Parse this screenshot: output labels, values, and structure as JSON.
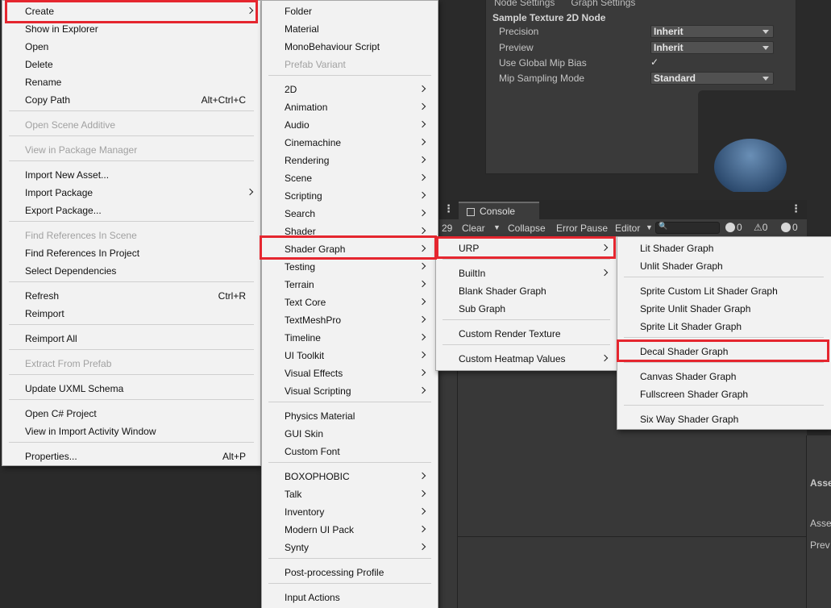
{
  "inspector": {
    "tabs": [
      "Node Settings",
      "Graph Settings"
    ],
    "title": "Sample Texture 2D Node",
    "rows": [
      {
        "label": "Precision",
        "value": "Inherit"
      },
      {
        "label": "Preview",
        "value": "Inherit"
      },
      {
        "label": "Use Global Mip Bias",
        "value": "✓"
      },
      {
        "label": "Mip Sampling Mode",
        "value": "Standard"
      }
    ]
  },
  "console": {
    "tab_label": "Console",
    "count_left": "29",
    "clear": "Clear",
    "collapse": "Collapse",
    "error_pause": "Error Pause",
    "editor": "Editor",
    "log_count": "0",
    "warn_count": "0",
    "error_count": "0"
  },
  "right_strip": {
    "label1": "Asse",
    "label2": "Asse",
    "label3": "Prev"
  },
  "menu1": {
    "items": [
      {
        "label": "Create",
        "submenu": true
      },
      {
        "label": "Show in Explorer"
      },
      {
        "label": "Open"
      },
      {
        "label": "Delete"
      },
      {
        "label": "Rename"
      },
      {
        "label": "Copy Path",
        "shortcut": "Alt+Ctrl+C"
      },
      {
        "label": "Open Scene Additive",
        "disabled": true
      },
      {
        "label": "View in Package Manager",
        "disabled": true
      },
      {
        "label": "Import New Asset..."
      },
      {
        "label": "Import Package",
        "submenu": true
      },
      {
        "label": "Export Package..."
      },
      {
        "label": "Find References In Scene",
        "disabled": true
      },
      {
        "label": "Find References In Project"
      },
      {
        "label": "Select Dependencies"
      },
      {
        "label": "Refresh",
        "shortcut": "Ctrl+R"
      },
      {
        "label": "Reimport"
      },
      {
        "label": "Reimport All"
      },
      {
        "label": "Extract From Prefab",
        "disabled": true
      },
      {
        "label": "Update UXML Schema"
      },
      {
        "label": "Open C# Project"
      },
      {
        "label": "View in Import Activity Window"
      },
      {
        "label": "Properties...",
        "shortcut": "Alt+P"
      }
    ]
  },
  "menu2": {
    "items": [
      {
        "label": "Folder"
      },
      {
        "label": "Material"
      },
      {
        "label": "MonoBehaviour Script"
      },
      {
        "label": "Prefab Variant",
        "disabled": true
      },
      {
        "label": "2D",
        "submenu": true
      },
      {
        "label": "Animation",
        "submenu": true
      },
      {
        "label": "Audio",
        "submenu": true
      },
      {
        "label": "Cinemachine",
        "submenu": true
      },
      {
        "label": "Rendering",
        "submenu": true
      },
      {
        "label": "Scene",
        "submenu": true
      },
      {
        "label": "Scripting",
        "submenu": true
      },
      {
        "label": "Search",
        "submenu": true
      },
      {
        "label": "Shader",
        "submenu": true
      },
      {
        "label": "Shader Graph",
        "submenu": true
      },
      {
        "label": "Testing",
        "submenu": true
      },
      {
        "label": "Terrain",
        "submenu": true
      },
      {
        "label": "Text Core",
        "submenu": true
      },
      {
        "label": "TextMeshPro",
        "submenu": true
      },
      {
        "label": "Timeline",
        "submenu": true
      },
      {
        "label": "UI Toolkit",
        "submenu": true
      },
      {
        "label": "Visual Effects",
        "submenu": true
      },
      {
        "label": "Visual Scripting",
        "submenu": true
      },
      {
        "label": "Physics Material"
      },
      {
        "label": "GUI Skin"
      },
      {
        "label": "Custom Font"
      },
      {
        "label": "BOXOPHOBIC",
        "submenu": true
      },
      {
        "label": "Talk",
        "submenu": true
      },
      {
        "label": "Inventory",
        "submenu": true
      },
      {
        "label": "Modern UI Pack",
        "submenu": true
      },
      {
        "label": "Synty",
        "submenu": true
      },
      {
        "label": "Post-processing Profile"
      },
      {
        "label": "Input Actions"
      }
    ]
  },
  "menu3": {
    "items": [
      {
        "label": "URP",
        "submenu": true
      },
      {
        "label": "BuiltIn",
        "submenu": true
      },
      {
        "label": "Blank Shader Graph"
      },
      {
        "label": "Sub Graph"
      },
      {
        "label": "Custom Render Texture"
      },
      {
        "label": "Custom Heatmap Values",
        "submenu": true
      }
    ]
  },
  "menu4": {
    "items": [
      {
        "label": "Lit Shader Graph"
      },
      {
        "label": "Unlit Shader Graph"
      },
      {
        "label": "Sprite Custom Lit Shader Graph"
      },
      {
        "label": "Sprite Unlit Shader Graph"
      },
      {
        "label": "Sprite Lit Shader Graph"
      },
      {
        "label": "Decal Shader Graph"
      },
      {
        "label": "Canvas Shader Graph"
      },
      {
        "label": "Fullscreen Shader Graph"
      },
      {
        "label": "Six Way Shader Graph"
      }
    ]
  },
  "colors": {
    "highlight": "#e5262f",
    "menu_bg": "#f2f2f2",
    "disabled_text": "#a1a1a1"
  }
}
